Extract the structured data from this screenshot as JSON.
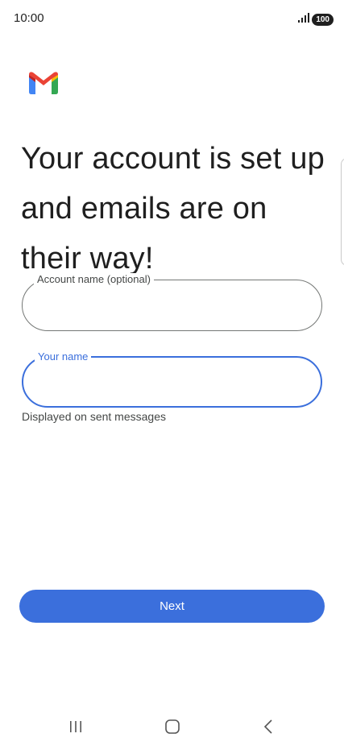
{
  "status_bar": {
    "time": "10:00",
    "battery": "100"
  },
  "icons": {
    "logo": "gmail-logo-icon",
    "signal": "signal-icon",
    "recents": "recents-icon",
    "home": "home-icon",
    "back": "back-icon"
  },
  "headline": "Your account is set up and emails are on their way!",
  "fields": {
    "account_name": {
      "label": "Account name (optional)",
      "value": "",
      "placeholder": ""
    },
    "your_name": {
      "label": "Your name",
      "value": "",
      "placeholder": "",
      "helper": "Displayed on sent messages"
    }
  },
  "next_button": {
    "label": "Next"
  },
  "colors": {
    "accent": "#3b6fdc",
    "outline": "#747775",
    "text": "#1f1f1f",
    "gmail_red": "#ea4335",
    "gmail_blue": "#4285f4",
    "gmail_green": "#34a853",
    "gmail_yellow": "#fbbc04",
    "gmail_dark_red": "#c5221f"
  }
}
